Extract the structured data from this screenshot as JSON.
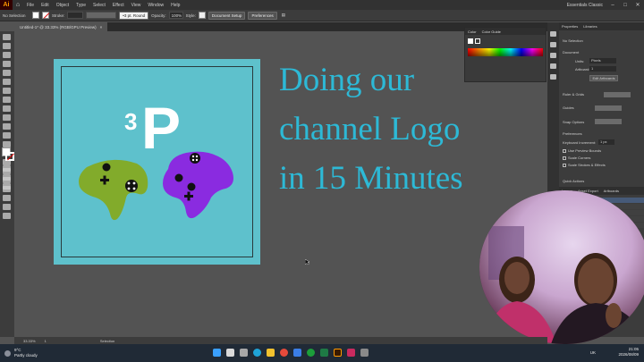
{
  "menubar": {
    "logo": "Ai",
    "items": [
      "File",
      "Edit",
      "Object",
      "Type",
      "Select",
      "Effect",
      "View",
      "Window",
      "Help"
    ],
    "workspace": "Essentials Classic"
  },
  "controlbar": {
    "selection": "No Selection",
    "stroke_label": "Stroke:",
    "brush": "3 pt. Round",
    "opacity_label": "Opacity:",
    "opacity_value": "100%",
    "style_label": "Style:",
    "document_setup": "Document Setup",
    "preferences": "Preferences"
  },
  "document_tab": {
    "title": "Untitled-1* @ 33.33% (RGB/GPU Preview)",
    "close": "×"
  },
  "artwork": {
    "logo_superscript": "3",
    "logo_letter": "P",
    "headline": [
      "Doing our",
      "channel Logo",
      "in 15 Minutes"
    ],
    "colors": {
      "artboard": "#5ec1cc",
      "green_controller": "#82ab2b",
      "purple_controller": "#8a2be0",
      "headline": "#2db9d6"
    }
  },
  "color_panel": {
    "tabs": [
      "Color",
      "Color Guide"
    ]
  },
  "properties_panel": {
    "tabs": [
      "Properties",
      "Libraries"
    ],
    "selection": "No Selection",
    "document_heading": "Document",
    "units_label": "Units:",
    "units_value": "Pixels",
    "artboard_label": "Artboard:",
    "artboard_value": "1",
    "edit_artboards": "Edit Artboards",
    "rulers_grids": "Ruler & Grids",
    "guides": "Guides",
    "snap_options": "Snap Options",
    "preferences_heading": "Preferences",
    "keyboard_increment_label": "Keyboard Increment:",
    "keyboard_increment_value": "1 px",
    "checkboxes": [
      "Use Preview Bounds",
      "Scale Corners",
      "Scale Strokes & Effects"
    ],
    "quick_actions": "Quick Actions"
  },
  "layers_panel": {
    "tabs": [
      "Layers",
      "Asset Export",
      "Artboards"
    ]
  },
  "statusbar": {
    "zoom": "33.33%",
    "artboard": "1",
    "tool": "Selection"
  },
  "taskbar": {
    "temperature": "9°C",
    "weather": "Partly cloudy",
    "language": "UK",
    "time": "21:05",
    "date": "2026/08/09"
  }
}
